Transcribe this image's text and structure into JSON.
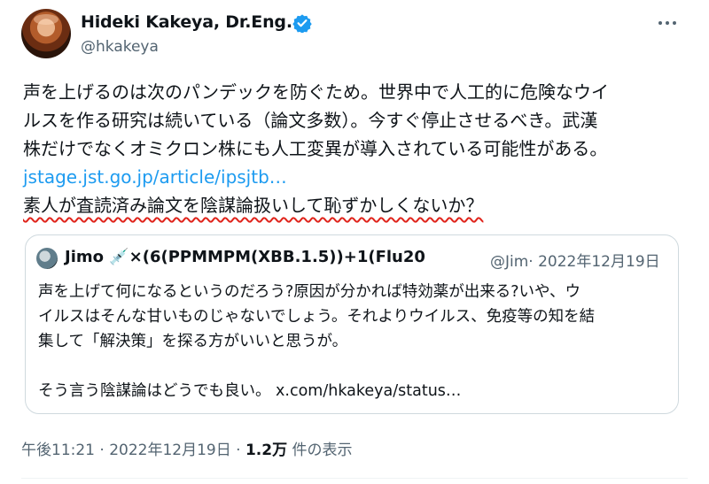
{
  "author": {
    "name": "Hideki Kakeya, Dr.Eng.",
    "handle": "@hkakeya"
  },
  "tweet": {
    "lines": [
      "声を上げるのは次のパンデックを防ぐため。世界中で人工的に危険なウイ",
      "ルスを作る研究は続いている（論文多数）。今すぐ停止させるべき。武漢",
      "株だけでなくオミクロン株にも人工変異が導入されている可能性がある。"
    ],
    "link": "jstage.jst.go.jp/article/ipsjtb…",
    "underlined_line": "素人が査読済み論文を陰謀論扱いして恥ずかしくないか？"
  },
  "quote": {
    "name": "Jimo 💉×(6(PPMMPM(XBB.1.5))+1(Flu20",
    "handle_date": "@Jim· 2022年12月19日",
    "lines": [
      "声を上げて何になるというのだろう?原因が分かれば特効薬が出来る?いや、ウ",
      "イルスはそんな甘いものじゃないでしょう。それよりウイルス、免疫等の知を結",
      "集して「解決策」を探る方がいいと思うが。",
      "",
      "そう言う陰謀論はどうでも良い。 x.com/hkakeya/status…"
    ]
  },
  "meta": {
    "time_date": "午後11:21 · 2022年12月19日 · ",
    "views_count": "1.2万",
    "views_label": " 件の表示"
  },
  "icons": {
    "verified": "verified-badge-icon",
    "more": "more-options-icon"
  },
  "colors": {
    "accent": "#1d9bf0",
    "underline": "#e0241b"
  }
}
